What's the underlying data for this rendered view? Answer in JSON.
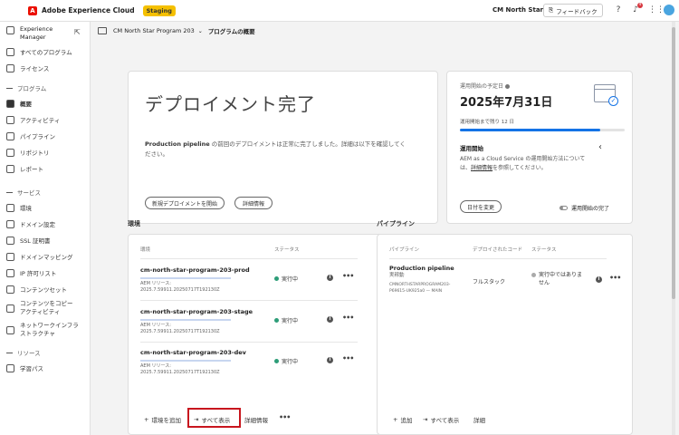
{
  "topbar": {
    "brand": "Adobe Experience Cloud",
    "badge": "Staging",
    "org": "CM North Star",
    "feedback": "フィードバック",
    "notification_count": "4"
  },
  "sidebar": {
    "app_name_line1": "Experience",
    "app_name_line2": "Manager",
    "items_top": [
      {
        "label": "すべてのプログラム",
        "icon": "folder-icon"
      },
      {
        "label": "ライセンス",
        "icon": "chart-icon"
      }
    ],
    "section_program": "プログラム",
    "items_program": [
      {
        "label": "概要",
        "icon": "overview-icon",
        "active": true
      },
      {
        "label": "アクティビティ",
        "icon": "bell-icon"
      },
      {
        "label": "パイプライン",
        "icon": "pipeline-icon"
      },
      {
        "label": "リポジトリ",
        "icon": "folder-icon"
      },
      {
        "label": "レポート",
        "icon": "report-icon"
      }
    ],
    "section_services": "サービス",
    "items_services": [
      {
        "label": "環境",
        "icon": "database-icon"
      },
      {
        "label": "ドメイン設定",
        "icon": "globe-icon"
      },
      {
        "label": "SSL 証明書",
        "icon": "certificate-icon"
      },
      {
        "label": "ドメインマッピング",
        "icon": "link-icon"
      },
      {
        "label": "IP 許可リスト",
        "icon": "ip-icon"
      },
      {
        "label": "コンテンツセット",
        "icon": "box-icon"
      },
      {
        "label": "コンテンツをコピー",
        "label2": "アクティビティ",
        "icon": "copy-icon"
      },
      {
        "label": "ネットワークインフラ",
        "label2": "ストラクチャ",
        "icon": "network-icon"
      }
    ],
    "section_resources": "リソース",
    "items_resources": [
      {
        "label": "学習パス",
        "icon": "book-icon"
      }
    ]
  },
  "breadcrumb": {
    "program": "CM North Star Program 203",
    "page": "プログラムの概要"
  },
  "hero": {
    "title": "デプロイメント完了",
    "text_bold": "Production pipeline",
    "text_rest": " の前回のデプロイメントは正常に完了しました。詳細は以下を確認してください。",
    "btn_new": "新規デプロイメントを開始",
    "btn_details": "詳細情報"
  },
  "golive": {
    "label": "運用開始の予定日",
    "date": "2025年7月31日",
    "remaining": "運用開始まで残り 12 日",
    "progress": 0.85,
    "subtitle": "運用開始",
    "desc_pre": "AEM as a Cloud Service の運用開始方法については、",
    "desc_link": "詳細情報",
    "desc_post": "を参照してください。",
    "btn_change": "日付を変更",
    "toggle_label": "運用開始の完了"
  },
  "environments": {
    "title": "環境",
    "col_env": "環境",
    "col_status": "ステータス",
    "rows": [
      {
        "name": "cm-north-star-program-203-prod",
        "release_label": "AEM リリース:",
        "release": "2025.7.59911.20250717T192130Z",
        "status": "実行中"
      },
      {
        "name": "cm-north-star-program-203-stage",
        "release_label": "AEM リリース:",
        "release": "2025.7.59911.20250717T192130Z",
        "status": "実行中"
      },
      {
        "name": "cm-north-star-program-203-dev",
        "release_label": "AEM リリース:",
        "release": "2025.7.59911.20250717T192130Z",
        "status": "実行中"
      }
    ],
    "add": "環境を追加",
    "show_all": "すべて表示",
    "details": "詳細情報"
  },
  "pipelines": {
    "title": "パイプライン",
    "col_pipeline": "パイプライン",
    "col_stack": "デプロイされたコード",
    "col_status": "ステータス",
    "rows": [
      {
        "name": "Production pipeline",
        "trigger": "実稼動",
        "repo": "CMNORTHSTARPROGRAM203-",
        "repo2": "P69615-UK925a0 — MAIN",
        "stack": "フルスタック",
        "status": "実行中ではありま",
        "status2": "せん"
      }
    ],
    "add": "追加",
    "show_all": "すべて表示",
    "details": "詳細"
  }
}
